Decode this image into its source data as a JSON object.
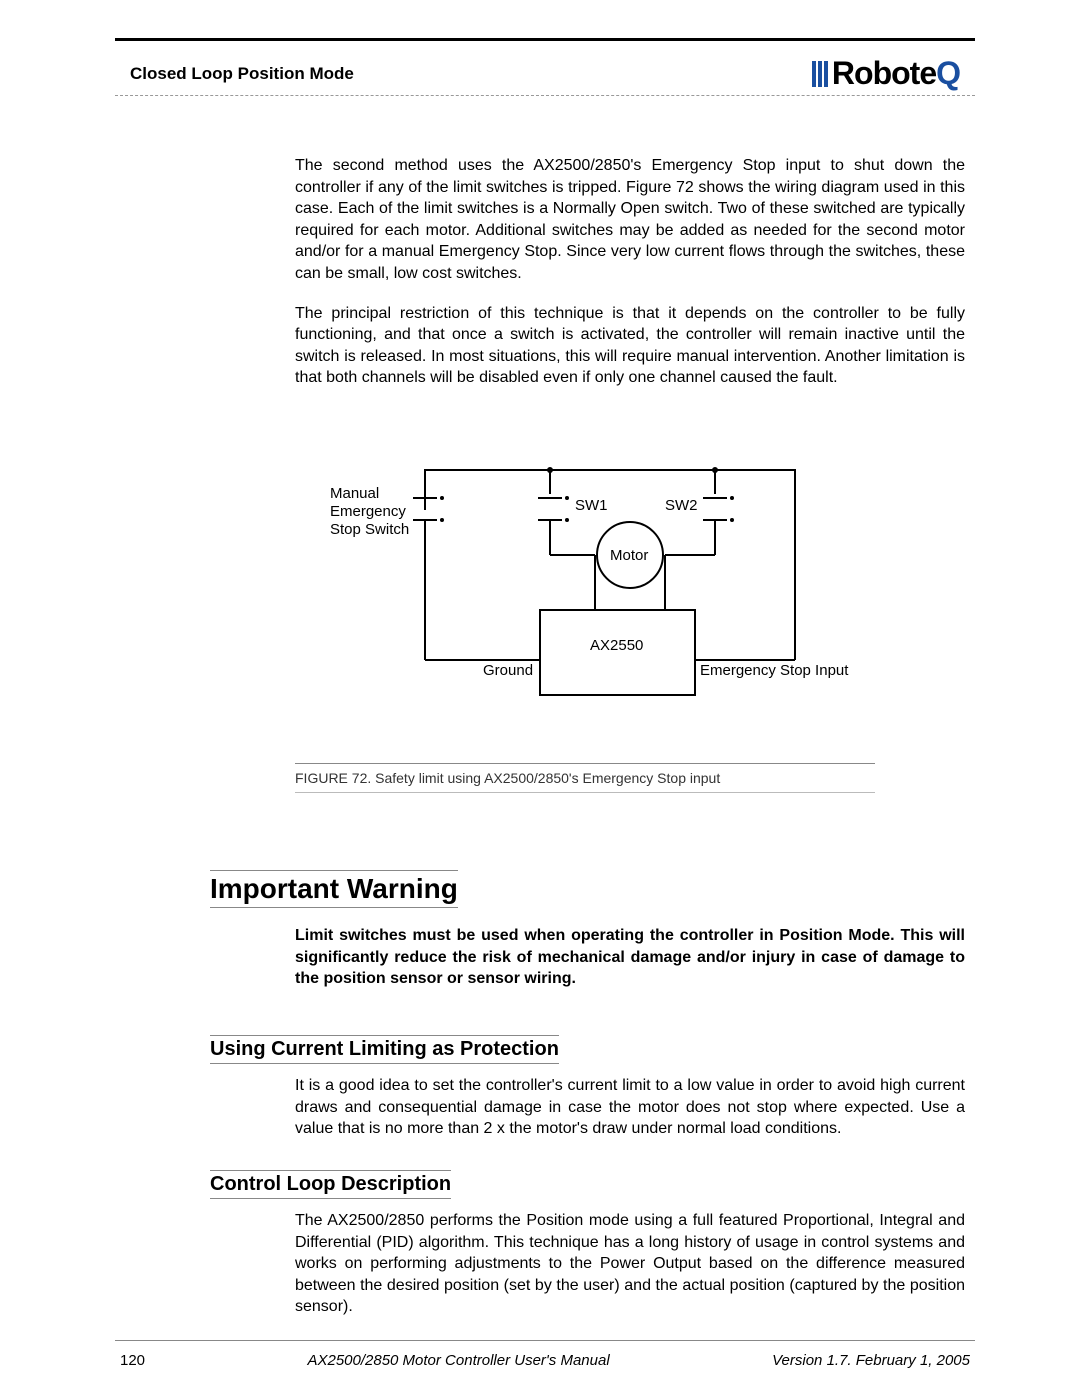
{
  "header": {
    "section": "Closed Loop Position Mode",
    "brand_main": "Robote",
    "brand_accent": "Q"
  },
  "paragraphs": {
    "p1": "The second method uses the AX2500/2850's Emergency Stop input to shut down the controller if any of the limit switches is tripped. Figure 72 shows the wiring diagram used in this case. Each of the limit switches is a Normally Open switch. Two of these switched are typically required for each motor. Additional switches may be added as needed for the second motor and/or for a manual Emergency Stop. Since very low current flows through the switches, these can be small, low cost switches.",
    "p2": "The principal restriction of this technique is that it depends on the controller to be fully functioning, and that once a switch is activated, the controller will remain inactive until the switch is released. In most situations, this will require manual intervention. Another limitation is that both channels will be disabled even if only one channel caused the fault."
  },
  "figure": {
    "labels": {
      "manual1": "Manual",
      "manual2": "Emergency",
      "manual3": "Stop Switch",
      "sw1": "SW1",
      "sw2": "SW2",
      "motor": "Motor",
      "controller": "AX2550",
      "ground": "Ground",
      "estop": "Emergency Stop Input"
    },
    "caption": "FIGURE 72.  Safety limit using AX2500/2850's Emergency Stop input"
  },
  "warning": {
    "title": "Important Warning",
    "body": "Limit switches must be used when operating the controller in Position Mode. This will significantly reduce the risk of mechanical damage and/or injury in case of damage to the position sensor or sensor wiring."
  },
  "sec_a": {
    "title": "Using Current Limiting as Protection",
    "body": "It is a good idea to set the controller's current limit to a low value in order to avoid high current draws and consequential damage in case the motor does not stop where expected. Use a value that is no more than 2 x the motor's draw under normal load conditions."
  },
  "sec_b": {
    "title": "Control Loop Description",
    "body": "The AX2500/2850 performs the Position mode using a full featured Proportional, Integral and Differential (PID) algorithm. This technique has a long history of usage in control systems and works on performing adjustments to the Power Output based on the difference measured between the desired position (set by the user) and the actual position (captured by the position sensor)."
  },
  "footer": {
    "page": "120",
    "center": "AX2500/2850 Motor Controller User's Manual",
    "right": "Version 1.7. February 1, 2005"
  }
}
